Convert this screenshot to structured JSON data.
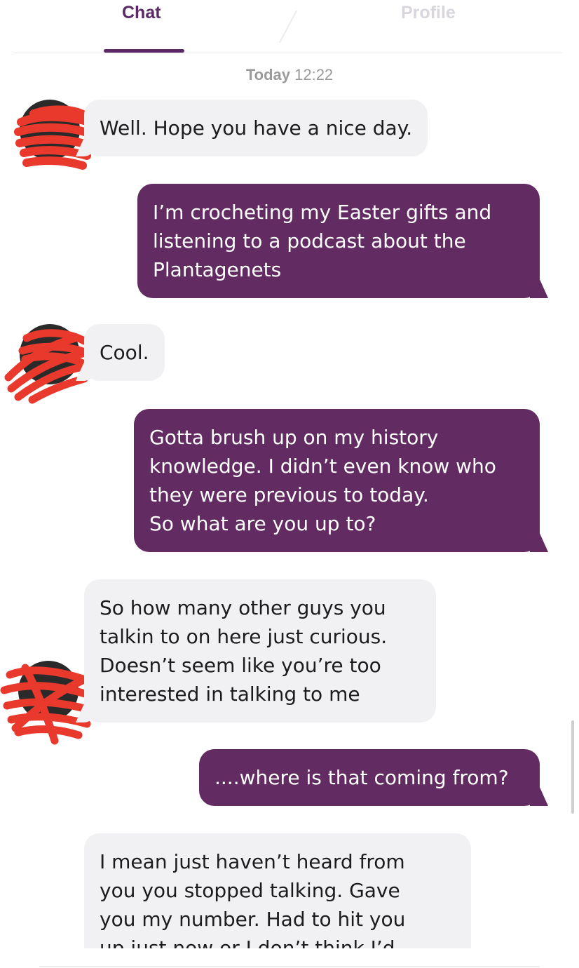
{
  "tabs": {
    "chat": "Chat",
    "profile": "Profile"
  },
  "date_stamp": {
    "day": "Today",
    "time": "12:22"
  },
  "messages": [
    {
      "from": "them",
      "text": "Well. Hope you have a nice day."
    },
    {
      "from": "me",
      "text": "I’m crocheting my Easter gifts and\nlistening to a podcast about the\nPlantagenets"
    },
    {
      "from": "them",
      "text": "Cool."
    },
    {
      "from": "me",
      "text": "Gotta brush up on my history\nknowledge. I didn’t even know who\nthey were previous to today.\nSo what are you up to?"
    },
    {
      "from": "them",
      "text": "So how many other guys you\ntalkin to on here just curious.\nDoesn’t seem like you’re too\ninterested in talking to me"
    },
    {
      "from": "me",
      "text": "....where is that coming from?"
    },
    {
      "from": "them",
      "text": "I mean just haven’t heard from\nyou you stopped talking. Gave\nyou my number.  Had to hit you\nup just now or I don’t think I’d"
    }
  ],
  "colors": {
    "accent": "#5b2a66",
    "outgoing_bubble": "#622b62",
    "incoming_bubble": "#f1f0f3",
    "redaction": "#e8392c"
  },
  "icons": {
    "avatar": "avatar-redacted"
  }
}
